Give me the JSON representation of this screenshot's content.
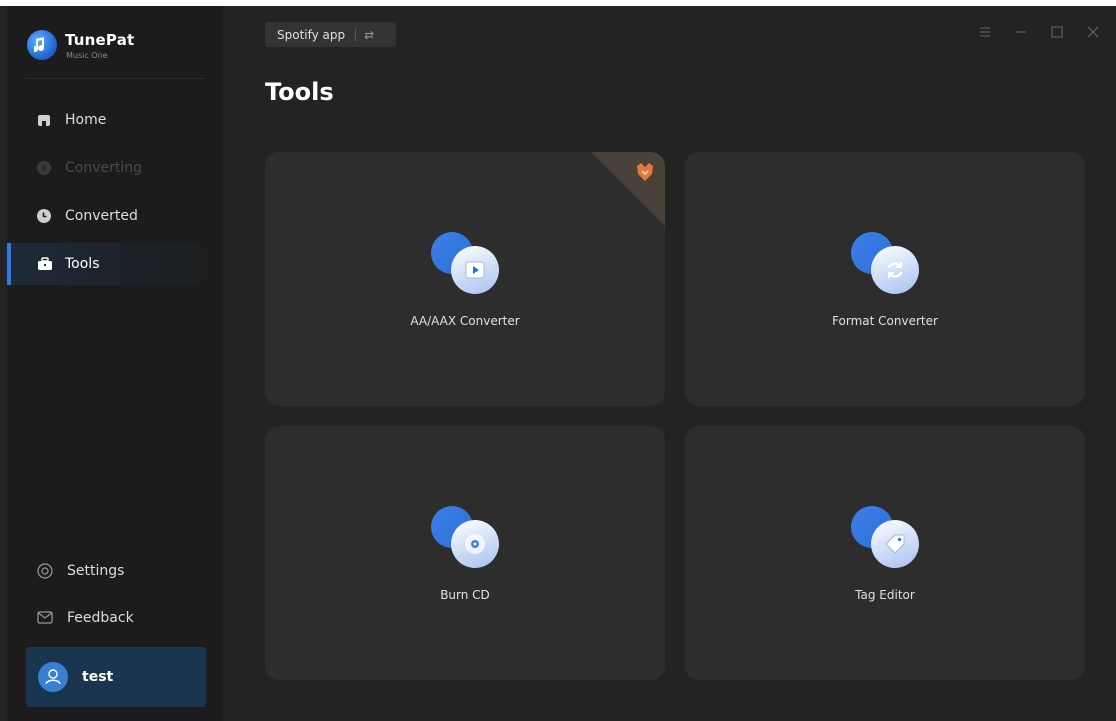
{
  "brand": {
    "name": "TunePat",
    "subtitle": "Music One"
  },
  "sidebar": {
    "items": [
      {
        "label": "Home",
        "icon": "home-icon",
        "state": "normal"
      },
      {
        "label": "Converting",
        "icon": "converting-icon",
        "state": "disabled"
      },
      {
        "label": "Converted",
        "icon": "clock-icon",
        "state": "normal"
      },
      {
        "label": "Tools",
        "icon": "toolbox-icon",
        "state": "active"
      }
    ],
    "bottom": [
      {
        "label": "Settings",
        "icon": "gear-icon"
      },
      {
        "label": "Feedback",
        "icon": "mail-icon"
      }
    ],
    "user": {
      "name": "test"
    }
  },
  "topbar": {
    "source_label": "Spotify app",
    "swap_glyph": "⇄"
  },
  "page": {
    "title": "Tools"
  },
  "tools": [
    {
      "label": "AA/AAX Converter",
      "icon": "video-play-icon",
      "badge": "fox-pro-badge"
    },
    {
      "label": "Format Converter",
      "icon": "refresh-icon"
    },
    {
      "label": "Burn CD",
      "icon": "disc-icon"
    },
    {
      "label": "Tag Editor",
      "icon": "tag-icon"
    }
  ],
  "colors": {
    "accent": "#2b7de9",
    "background": "#232323",
    "sidebar": "#1c1c1c",
    "card": "#2d2d2d",
    "user_box": "#1a3550",
    "badge_orange": "#e07a3f"
  }
}
